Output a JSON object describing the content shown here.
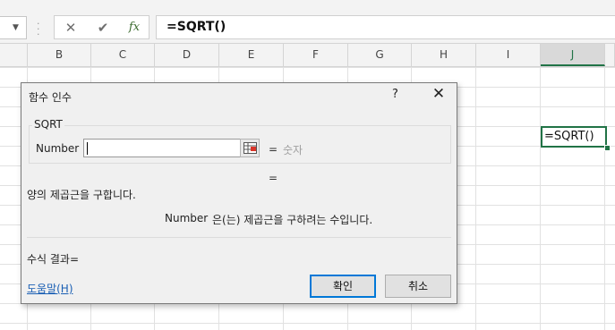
{
  "formula_bar": {
    "cancel_icon": "x-icon",
    "enter_icon": "checkmark-icon",
    "fx_label": "fx",
    "content": "=SQRT()"
  },
  "columns": [
    "B",
    "C",
    "D",
    "E",
    "F",
    "G",
    "H",
    "I",
    "J"
  ],
  "selected_column": "J",
  "active_cell": {
    "content": "=SQRT()"
  },
  "dialog": {
    "title": "함수 인수",
    "help_glyph": "?",
    "close_glyph": "✕",
    "function_name": "SQRT",
    "argument": {
      "label": "Number",
      "value": "",
      "equals": "=",
      "type_hint": "숫자"
    },
    "result_equals": "=",
    "function_description": "양의 제곱근을 구합니다.",
    "argument_description": {
      "name": "Number",
      "text": "은(는) 제곱근을 구하려는 수입니다."
    },
    "formula_result": "수식 결과=",
    "help_link": "도움말(H)",
    "ok_label": "확인",
    "cancel_label": "취소"
  },
  "colors": {
    "accent_green": "#217346",
    "link_blue": "#1a5fb4",
    "focus_blue": "#0078d7"
  }
}
